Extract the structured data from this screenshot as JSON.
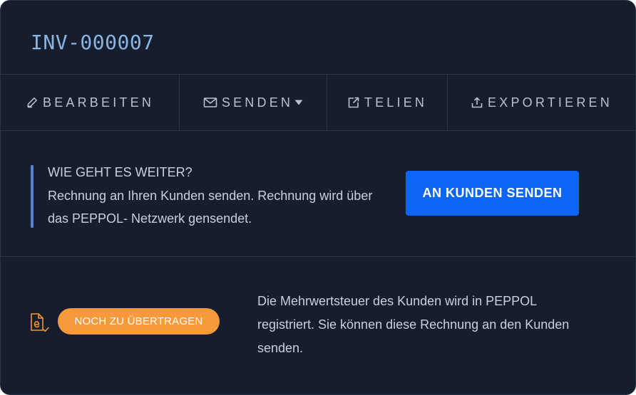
{
  "invoice": {
    "number": "INV-000007"
  },
  "toolbar": {
    "items": [
      {
        "label": "BEARBEITEN",
        "icon": "pencil-icon"
      },
      {
        "label": "SENDEN",
        "icon": "mail-icon",
        "dropdown": true
      },
      {
        "label": "TELIEN",
        "icon": "share-icon"
      },
      {
        "label": "EXPORTIEREN",
        "icon": "upload-icon"
      }
    ]
  },
  "next_steps": {
    "heading": "WIE GEHT ES WEITER?",
    "text": "Rechnung an Ihren Kunden senden. Rechnung wird über das PEPPOL- Netzwerk gensendet.",
    "button_label": "AN KUNDEN SENDEN"
  },
  "status": {
    "icon": "e-invoice-document-icon",
    "badge": "NOCH ZU ÜBERTRAGEN",
    "text": "Die Mehrwertsteuer des Kunden wird in PEPPOL registriert. Sie können diese Rechnung an den Kunden senden."
  },
  "colors": {
    "background": "#161d2c",
    "accent_blue": "#0b66f5",
    "badge_orange": "#f89a3c",
    "title_blue": "#8ab4e4",
    "next_bar": "#5b7fd1"
  }
}
